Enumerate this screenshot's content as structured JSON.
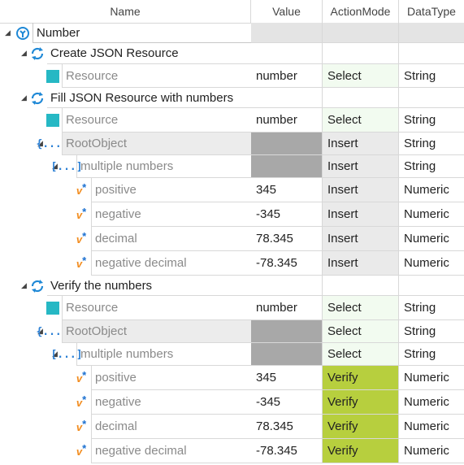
{
  "columns": {
    "name": "Name",
    "value": "Value",
    "action": "ActionMode",
    "type": "DataType"
  },
  "colors": {
    "verify": "#b7cf3e",
    "select_light": "#f2fbf0",
    "insert_bg": "#eaeaea",
    "empty_gray": "#a8a8a8",
    "header_gray": "#e4e4e4",
    "teal": "#26b8c4"
  },
  "rows": [
    {
      "kind": "root",
      "name": "Number",
      "value": "",
      "action": "",
      "type": ""
    },
    {
      "kind": "module",
      "name": "Create JSON Resource",
      "value": "",
      "action": "",
      "type": ""
    },
    {
      "kind": "resource",
      "name": "Resource",
      "value": "number",
      "action": "Select",
      "type": "String"
    },
    {
      "kind": "module",
      "name": "Fill JSON Resource with numbers",
      "value": "",
      "action": "",
      "type": ""
    },
    {
      "kind": "resource",
      "name": "Resource",
      "value": "number",
      "action": "Select",
      "type": "String"
    },
    {
      "kind": "object",
      "name": "RootObject",
      "value": "",
      "action": "Insert",
      "type": "String"
    },
    {
      "kind": "array",
      "name": "multiple numbers",
      "value": "",
      "action": "Insert",
      "type": "String"
    },
    {
      "kind": "var",
      "name": "positive",
      "value": "345",
      "action": "Insert",
      "type": "Numeric"
    },
    {
      "kind": "var",
      "name": "negative",
      "value": "-345",
      "action": "Insert",
      "type": "Numeric"
    },
    {
      "kind": "var",
      "name": "decimal",
      "value": "78.345",
      "action": "Insert",
      "type": "Numeric"
    },
    {
      "kind": "var",
      "name": "negative decimal",
      "value": "-78.345",
      "action": "Insert",
      "type": "Numeric"
    },
    {
      "kind": "module",
      "name": "Verify the numbers",
      "value": "",
      "action": "",
      "type": ""
    },
    {
      "kind": "resource",
      "name": "Resource",
      "value": "number",
      "action": "Select",
      "type": "String"
    },
    {
      "kind": "object",
      "name": "RootObject",
      "value": "",
      "action": "Select",
      "type": "String"
    },
    {
      "kind": "array",
      "name": "multiple numbers",
      "value": "",
      "action": "Select",
      "type": "String"
    },
    {
      "kind": "var",
      "name": "positive",
      "value": "345",
      "action": "Verify",
      "type": "Numeric"
    },
    {
      "kind": "var",
      "name": "negative",
      "value": "-345",
      "action": "Verify",
      "type": "Numeric"
    },
    {
      "kind": "var",
      "name": "decimal",
      "value": "78.345",
      "action": "Verify",
      "type": "Numeric"
    },
    {
      "kind": "var",
      "name": "negative decimal",
      "value": "-78.345",
      "action": "Verify",
      "type": "Numeric"
    }
  ]
}
